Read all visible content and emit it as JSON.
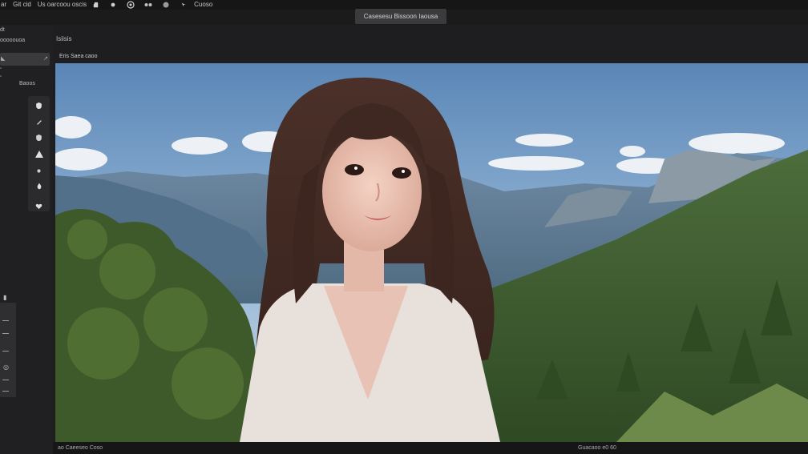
{
  "menubar": {
    "items": [
      "ar",
      "Git cid",
      "Us oarcoou oscis",
      "Cuoso"
    ]
  },
  "title_pill": "Casesesu Bissoon Iaousa",
  "left_panel": {
    "header_a": "dt",
    "header_b": "ooooouoa",
    "field_label": "Baoos"
  },
  "document": {
    "tab_label": "Isiisis",
    "info_label": "Eris Saea caoo"
  },
  "statusbar": {
    "left": "ao Caeeseo Coso",
    "right": "Guacaoo e0 60"
  },
  "colors": {
    "app_bg": "#1c1c1e",
    "panel_bg": "#202022",
    "pill_bg": "#3b3b3e",
    "sky": "#7fa6cf",
    "forest": "#3e5a2c"
  },
  "icons": [
    "hand-icon",
    "shape-icon",
    "eye-icon",
    "glasses-icon",
    "circle-icon",
    "arrow-icon",
    "shield-icon",
    "pen-icon",
    "triangle-icon",
    "brush-icon",
    "drop-icon"
  ]
}
